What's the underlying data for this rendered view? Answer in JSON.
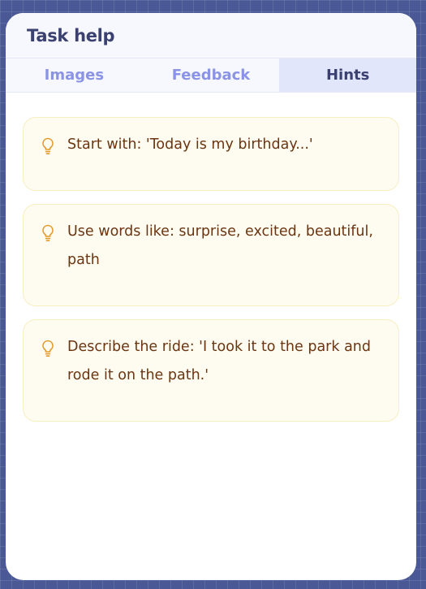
{
  "panel": {
    "title": "Task help"
  },
  "tabs": [
    {
      "label": "Images",
      "active": false
    },
    {
      "label": "Feedback",
      "active": false
    },
    {
      "label": "Hints",
      "active": true
    }
  ],
  "hints": [
    {
      "icon": "lightbulb-icon",
      "text": "Start with: 'Today is my birthday...'"
    },
    {
      "icon": "lightbulb-icon",
      "text": "Use words like: surprise, excited, beautiful, path"
    },
    {
      "icon": "lightbulb-icon",
      "text": "Describe the ride: 'I took it to the park and rode it on the path.'"
    }
  ],
  "colors": {
    "background": "#4a5996",
    "accent_tab_text": "#8a93e6",
    "active_tab_bg": "#e1e6fb",
    "hint_bg": "#fefcf1",
    "hint_text": "#6b3511",
    "hint_icon": "#e39a2c"
  }
}
